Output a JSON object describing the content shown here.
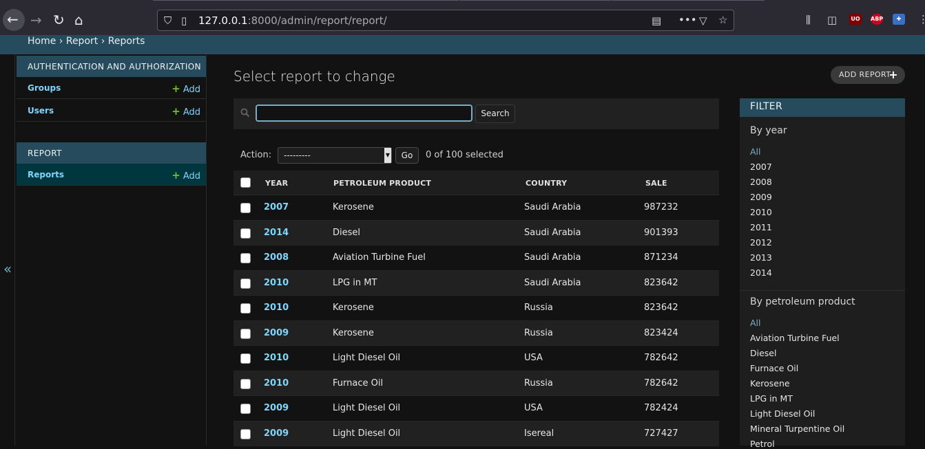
{
  "browser": {
    "url_host": "127.0.0.1",
    "url_rest": ":8000/admin/report/report/",
    "extensions": [
      "uBlock",
      "ABP"
    ]
  },
  "breadcrumbs": "Home › Report › Reports",
  "sidebar": {
    "auth_caption": "AUTHENTICATION AND AUTHORIZATION",
    "auth_items": [
      {
        "label": "Groups",
        "add": "Add"
      },
      {
        "label": "Users",
        "add": "Add"
      }
    ],
    "report_caption": "REPORT",
    "report_items": [
      {
        "label": "Reports",
        "add": "Add"
      }
    ],
    "collapse_glyph": "«"
  },
  "main": {
    "title": "Select report to change",
    "add_button": "ADD REPORT",
    "search": {
      "value": "",
      "button": "Search"
    },
    "actions": {
      "label": "Action:",
      "selected": "---------",
      "go": "Go",
      "count": "0 of 100 selected"
    },
    "columns": [
      "YEAR",
      "PETROLEUM PRODUCT",
      "COUNTRY",
      "SALE"
    ],
    "rows": [
      {
        "year": "2007",
        "product": "Kerosene",
        "country": "Saudi Arabia",
        "sale": "987232"
      },
      {
        "year": "2014",
        "product": "Diesel",
        "country": "Saudi Arabia",
        "sale": "901393"
      },
      {
        "year": "2008",
        "product": "Aviation Turbine Fuel",
        "country": "Saudi Arabia",
        "sale": "871234"
      },
      {
        "year": "2010",
        "product": "LPG in MT",
        "country": "Saudi Arabia",
        "sale": "823642"
      },
      {
        "year": "2010",
        "product": "Kerosene",
        "country": "Russia",
        "sale": "823642"
      },
      {
        "year": "2009",
        "product": "Kerosene",
        "country": "Russia",
        "sale": "823424"
      },
      {
        "year": "2010",
        "product": "Light Diesel Oil",
        "country": "USA",
        "sale": "782642"
      },
      {
        "year": "2010",
        "product": "Furnace Oil",
        "country": "Russia",
        "sale": "782642"
      },
      {
        "year": "2009",
        "product": "Light Diesel Oil",
        "country": "USA",
        "sale": "782424"
      },
      {
        "year": "2009",
        "product": "Light Diesel Oil",
        "country": "Isereal",
        "sale": "727427"
      }
    ]
  },
  "filter": {
    "caption": "FILTER",
    "by_year": {
      "heading": "By year",
      "items": [
        "All",
        "2007",
        "2008",
        "2009",
        "2010",
        "2011",
        "2012",
        "2013",
        "2014"
      ]
    },
    "by_product": {
      "heading": "By petroleum product",
      "items": [
        "All",
        "Aviation Turbine Fuel",
        "Diesel",
        "Furnace Oil",
        "Kerosene",
        "LPG in MT",
        "Light Diesel Oil",
        "Mineral Turpentine Oil",
        "Petrol"
      ]
    }
  },
  "colors": {
    "header": "#264b5d",
    "link": "#81d4fa",
    "accent_yellow": "#f5dd5d",
    "add_green": "#70bf2b",
    "current_row": "#00363d"
  }
}
